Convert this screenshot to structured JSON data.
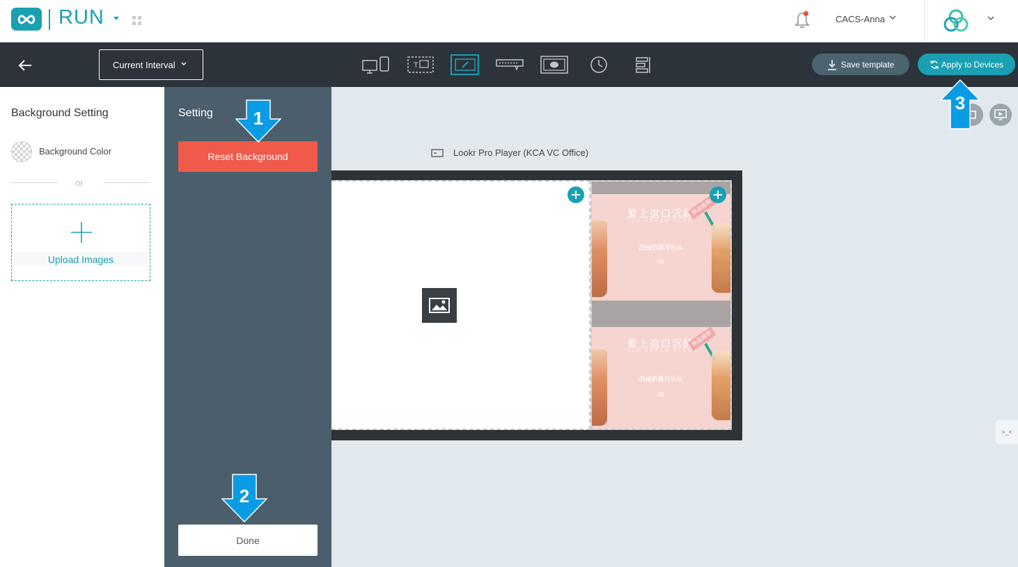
{
  "header": {
    "app_name": "RUN",
    "username": "CACS-Anna",
    "icons": [
      "infinity-logo-icon",
      "chevron-down-icon",
      "apps-grid-icon",
      "bell-icon",
      "brand-logo-icon"
    ]
  },
  "toolbar": {
    "interval_label": "Current Interval",
    "tools": [
      "screen-layout-icon",
      "text-template-icon",
      "background-edit-icon",
      "marquee-icon",
      "media-frame-icon",
      "clock-icon",
      "align-icon"
    ],
    "active_tool": "background-edit-icon",
    "save_label": "Save template",
    "apply_label": "Apply to Devices"
  },
  "left_panel": {
    "title": "Background Setting",
    "bg_color_label": "Background Color",
    "or_text": "or",
    "upload_label": "Upload Images"
  },
  "setting_panel": {
    "title": "Setting",
    "reset_label": "Reset Background",
    "done_label": "Done"
  },
  "canvas": {
    "player_label": "Lookr Pro Player (KCA VC Office)",
    "promo": {
      "title": "爱上这口沉醉",
      "subtitle": "ICE CREAM PLUS",
      "name": "西柚奶霸浮乐朵",
      "price": "48",
      "tag": "新品推荐"
    },
    "feedback_label": ">_<"
  },
  "annotations": {
    "step1": "1",
    "step2": "2",
    "step3": "3"
  },
  "colors": {
    "accent": "#1aa0b2",
    "toolbar_bg": "#2c333a",
    "setting_bg": "#4a5f6b",
    "reset_red": "#ef5a4a",
    "arrow_blue": "#0a9be5"
  }
}
